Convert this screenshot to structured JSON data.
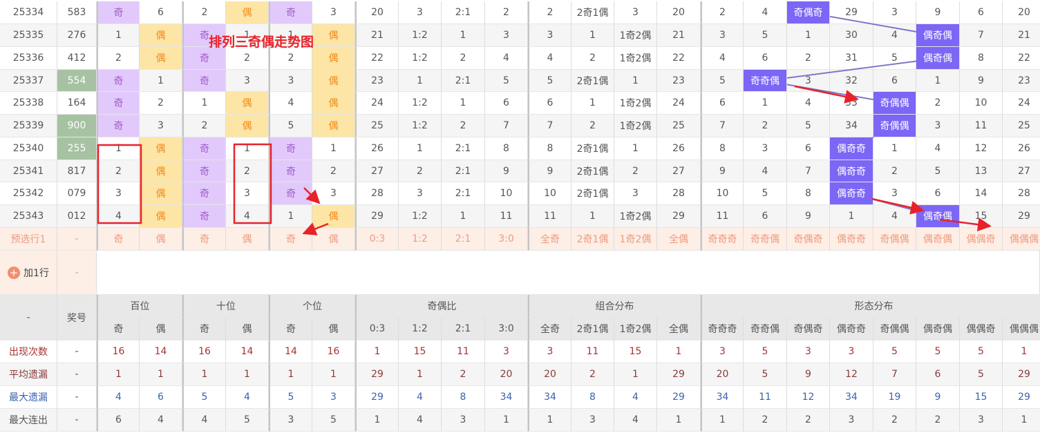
{
  "annotation_title": "排列三奇偶走势图",
  "colors": {
    "odd_bg": "#e2c9fb",
    "even_bg": "#fde5a6",
    "ratio_bg": "#7b66f5",
    "number_bg": "#a6c2a2",
    "annotation": "#e8222a"
  },
  "rows": [
    {
      "period": "25334",
      "number": "583",
      "green": false,
      "cells": [
        "奇",
        "6",
        "2",
        "偶",
        "奇",
        "3",
        "20",
        "3",
        "2:1",
        "2",
        "2",
        "2奇1偶",
        "3",
        "20",
        "2",
        "4",
        "奇偶奇",
        "29",
        "3",
        "9",
        "6",
        "20"
      ]
    },
    {
      "period": "25335",
      "number": "276",
      "green": false,
      "cells": [
        "1",
        "偶",
        "奇",
        "1",
        "1",
        "偶",
        "21",
        "1:2",
        "1",
        "3",
        "3",
        "1",
        "1奇2偶",
        "21",
        "3",
        "5",
        "1",
        "30",
        "4",
        "偶奇偶",
        "7",
        "21"
      ]
    },
    {
      "period": "25336",
      "number": "412",
      "green": false,
      "cells": [
        "2",
        "偶",
        "奇",
        "2",
        "2",
        "偶",
        "22",
        "1:2",
        "2",
        "4",
        "4",
        "2",
        "1奇2偶",
        "22",
        "4",
        "6",
        "2",
        "31",
        "5",
        "偶奇偶",
        "8",
        "22"
      ]
    },
    {
      "period": "25337",
      "number": "554",
      "green": true,
      "cells": [
        "奇",
        "1",
        "奇",
        "3",
        "3",
        "偶",
        "23",
        "1",
        "2:1",
        "5",
        "5",
        "2奇1偶",
        "1",
        "23",
        "5",
        "奇奇偶",
        "3",
        "32",
        "6",
        "1",
        "9",
        "23"
      ]
    },
    {
      "period": "25338",
      "number": "164",
      "green": false,
      "cells": [
        "奇",
        "2",
        "1",
        "偶",
        "4",
        "偶",
        "24",
        "1:2",
        "1",
        "6",
        "6",
        "1",
        "1奇2偶",
        "24",
        "6",
        "1",
        "4",
        "33",
        "奇偶偶",
        "2",
        "10",
        "24"
      ]
    },
    {
      "period": "25339",
      "number": "900",
      "green": true,
      "cells": [
        "奇",
        "3",
        "2",
        "偶",
        "5",
        "偶",
        "25",
        "1:2",
        "2",
        "7",
        "7",
        "2",
        "1奇2偶",
        "25",
        "7",
        "2",
        "5",
        "34",
        "奇偶偶",
        "3",
        "11",
        "25"
      ]
    },
    {
      "period": "25340",
      "number": "255",
      "green": true,
      "cells": [
        "1",
        "偶",
        "奇",
        "1",
        "奇",
        "1",
        "26",
        "1",
        "2:1",
        "8",
        "8",
        "2奇1偶",
        "1",
        "26",
        "8",
        "3",
        "6",
        "偶奇奇",
        "1",
        "4",
        "12",
        "26"
      ]
    },
    {
      "period": "25341",
      "number": "817",
      "green": false,
      "cells": [
        "2",
        "偶",
        "奇",
        "2",
        "奇",
        "2",
        "27",
        "2",
        "2:1",
        "9",
        "9",
        "2奇1偶",
        "2",
        "27",
        "9",
        "4",
        "7",
        "偶奇奇",
        "2",
        "5",
        "13",
        "27"
      ]
    },
    {
      "period": "25342",
      "number": "079",
      "green": false,
      "cells": [
        "3",
        "偶",
        "奇",
        "3",
        "奇",
        "3",
        "28",
        "3",
        "2:1",
        "10",
        "10",
        "2奇1偶",
        "3",
        "28",
        "10",
        "5",
        "8",
        "偶奇奇",
        "3",
        "6",
        "14",
        "28"
      ]
    },
    {
      "period": "25343",
      "number": "012",
      "green": false,
      "cells": [
        "4",
        "偶",
        "奇",
        "4",
        "1",
        "偶",
        "29",
        "1:2",
        "1",
        "11",
        "11",
        "1",
        "1奇2偶",
        "29",
        "11",
        "6",
        "9",
        "1",
        "4",
        "偶奇偶",
        "15",
        "29"
      ]
    }
  ],
  "preselect": {
    "label": "预选行1",
    "number": "-",
    "cells": [
      "奇",
      "偶",
      "奇",
      "偶",
      "奇",
      "偶",
      "0:3",
      "1:2",
      "2:1",
      "3:0",
      "全奇",
      "2奇1偶",
      "1奇2偶",
      "全偶",
      "奇奇奇",
      "奇奇偶",
      "奇偶奇",
      "偶奇奇",
      "奇偶偶",
      "偶奇偶",
      "偶偶奇",
      "偶偶偶"
    ]
  },
  "add_row": {
    "label": "加1行",
    "number": "-"
  },
  "header": {
    "corner": "-",
    "number": "奖号",
    "groups": [
      "百位",
      "十位",
      "个位",
      "奇偶比",
      "组合分布",
      "形态分布"
    ],
    "sub": [
      "奇",
      "偶",
      "奇",
      "偶",
      "奇",
      "偶",
      "0:3",
      "1:2",
      "2:1",
      "3:0",
      "全奇",
      "2奇1偶",
      "1奇2偶",
      "全偶",
      "奇奇奇",
      "奇奇偶",
      "奇偶奇",
      "偶奇奇",
      "奇偶偶",
      "偶奇偶",
      "偶偶奇",
      "偶偶偶"
    ]
  },
  "stats": [
    {
      "label": "出现次数",
      "number": "-",
      "values": [
        "16",
        "14",
        "16",
        "14",
        "14",
        "16",
        "1",
        "15",
        "11",
        "3",
        "3",
        "11",
        "15",
        "1",
        "3",
        "5",
        "3",
        "3",
        "5",
        "5",
        "5",
        "1"
      ]
    },
    {
      "label": "平均遗漏",
      "number": "-",
      "values": [
        "1",
        "1",
        "1",
        "1",
        "1",
        "1",
        "29",
        "1",
        "2",
        "20",
        "20",
        "2",
        "1",
        "29",
        "20",
        "5",
        "9",
        "12",
        "7",
        "6",
        "5",
        "29"
      ]
    },
    {
      "label": "最大遗漏",
      "number": "-",
      "values": [
        "4",
        "6",
        "5",
        "4",
        "5",
        "3",
        "29",
        "4",
        "8",
        "34",
        "34",
        "8",
        "4",
        "29",
        "34",
        "11",
        "12",
        "34",
        "19",
        "9",
        "15",
        "29"
      ]
    },
    {
      "label": "最大连出",
      "number": "-",
      "values": [
        "6",
        "4",
        "4",
        "5",
        "3",
        "5",
        "1",
        "4",
        "3",
        "1",
        "1",
        "3",
        "4",
        "1",
        "1",
        "2",
        "2",
        "3",
        "2",
        "2",
        "3",
        "1"
      ]
    }
  ]
}
